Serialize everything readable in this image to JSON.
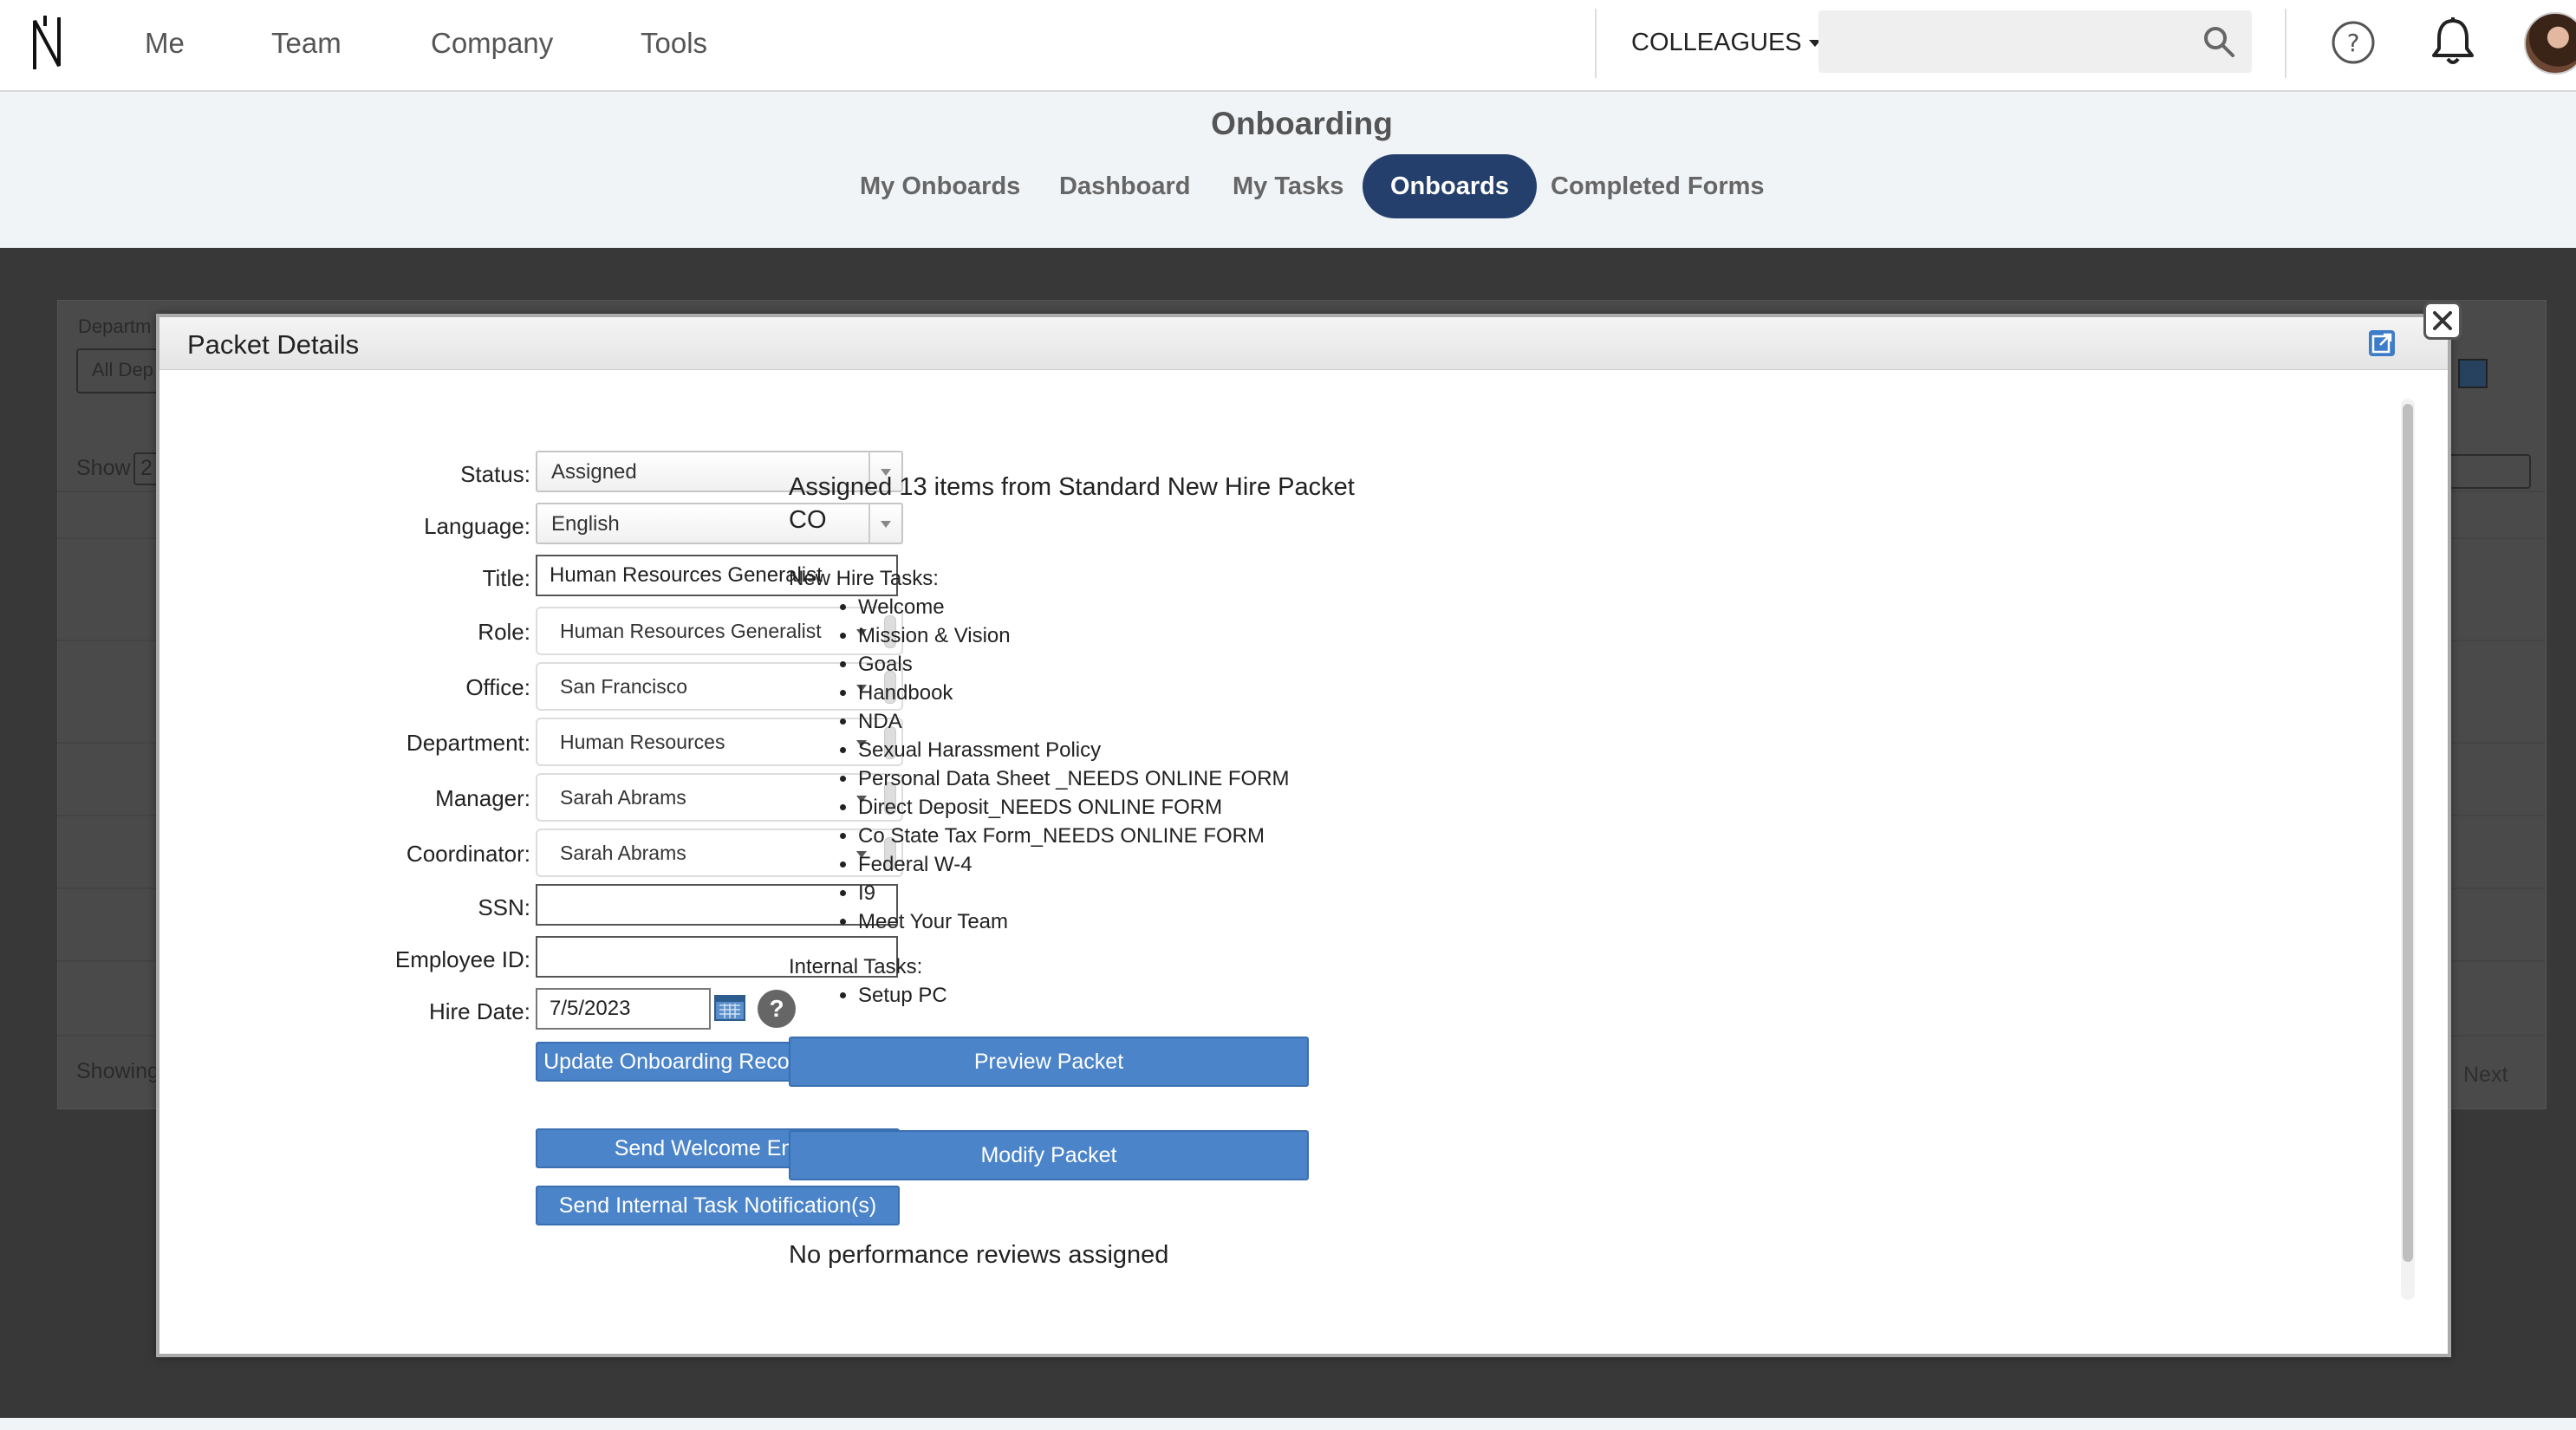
{
  "nav": {
    "items": [
      "Me",
      "Team",
      "Company",
      "Tools"
    ],
    "colleagues_label": "COLLEAGUES",
    "search_placeholder": ""
  },
  "subheader": {
    "title": "Onboarding",
    "tabs": [
      "My Onboards",
      "Dashboard",
      "My Tasks",
      "Onboards",
      "Completed Forms"
    ],
    "active_tab": "Onboards"
  },
  "background": {
    "department_label": "Departm",
    "department_value": "All Dep",
    "show_label": "Show",
    "show_value": "2",
    "showing_label": "Showing",
    "next_label": "Next"
  },
  "modal": {
    "title": "Packet Details",
    "form": {
      "status_label": "Status:",
      "status_value": "Assigned",
      "language_label": "Language:",
      "language_value": "English",
      "title_label": "Title:",
      "title_value": "Human Resources Generalist",
      "role_label": "Role:",
      "role_value": "Human Resources Generalist",
      "office_label": "Office:",
      "office_value": "San Francisco",
      "department_label": "Department:",
      "department_value": "Human Resources",
      "manager_label": "Manager:",
      "manager_value": "Sarah Abrams",
      "coordinator_label": "Coordinator:",
      "coordinator_value": "Sarah Abrams",
      "ssn_label": "SSN:",
      "ssn_value": "",
      "employee_id_label": "Employee ID:",
      "employee_id_value": "",
      "hire_date_label": "Hire Date:",
      "hire_date_value": "7/5/2023",
      "help_symbol": "?",
      "update_button": "Update Onboarding Record",
      "welcome_button": "Send Welcome Email",
      "notify_button": "Send Internal Task Notification(s)"
    },
    "packet": {
      "assigned_line1": "Assigned 13 items from Standard New Hire Packet",
      "assigned_line2": "CO",
      "new_hire_heading": "New Hire Tasks:",
      "new_hire_tasks": [
        "Welcome",
        "Mission & Vision",
        "Goals",
        "Handbook",
        "NDA",
        "Sexual Harassment Policy",
        "Personal Data Sheet _NEEDS ONLINE FORM",
        "Direct Deposit_NEEDS ONLINE FORM",
        "Co State Tax Form_NEEDS ONLINE FORM",
        "Federal W-4",
        "I9",
        "Meet Your Team"
      ],
      "internal_heading": "Internal Tasks:",
      "internal_tasks": [
        "Setup PC"
      ],
      "preview_button": "Preview Packet",
      "modify_button": "Modify Packet",
      "reviews_text": "No performance reviews assigned"
    }
  },
  "colors": {
    "active_tab_bg": "#253f6c",
    "button_blue": "#4b84c9",
    "backdrop": "#383838"
  }
}
